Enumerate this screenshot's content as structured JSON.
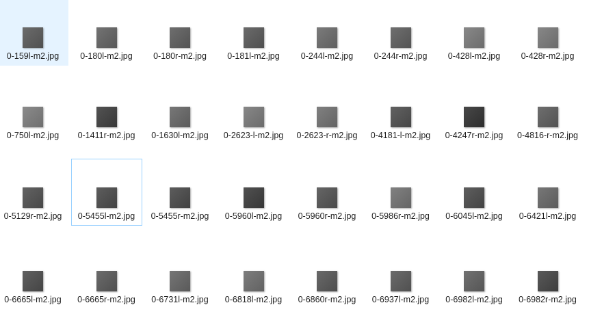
{
  "icon_name": "image-thumbnail-icon",
  "files": [
    {
      "name": "0-159l-m2.jpg",
      "tone": "#5b5b5b",
      "selected": true
    },
    {
      "name": "0-180l-m2.jpg",
      "tone": "#636363"
    },
    {
      "name": "0-180r-m2.jpg",
      "tone": "#5e5e5e"
    },
    {
      "name": "0-181l-m2.jpg",
      "tone": "#5a5a5a"
    },
    {
      "name": "0-244l-m2.jpg",
      "tone": "#6c6c6c"
    },
    {
      "name": "0-244r-m2.jpg",
      "tone": "#5f5f5f"
    },
    {
      "name": "0-428l-m2.jpg",
      "tone": "#7b7b7b"
    },
    {
      "name": "0-428r-m2.jpg",
      "tone": "#7a7a7a"
    },
    {
      "name": "0-750l-m2.jpg",
      "tone": "#7e7e7e"
    },
    {
      "name": "0-1411r-m2.jpg",
      "tone": "#3f3f3f"
    },
    {
      "name": "0-1630l-m2.jpg",
      "tone": "#686868"
    },
    {
      "name": "0-2623-l-m2.jpg",
      "tone": "#7a7a7a"
    },
    {
      "name": "0-2623-r-m2.jpg",
      "tone": "#727272"
    },
    {
      "name": "0-4181-l-m2.jpg",
      "tone": "#505050"
    },
    {
      "name": "0-4247r-m2.jpg",
      "tone": "#333333"
    },
    {
      "name": "0-4816-r-m2.jpg",
      "tone": "#5e5e5e"
    },
    {
      "name": "0-5129r-m2.jpg",
      "tone": "#515151"
    },
    {
      "name": "0-5455l-m2.jpg",
      "tone": "#4b4b4b",
      "focused": true
    },
    {
      "name": "0-5455r-m2.jpg",
      "tone": "#4a4a4a"
    },
    {
      "name": "0-5960l-m2.jpg",
      "tone": "#3d3d3d"
    },
    {
      "name": "0-5960r-m2.jpg",
      "tone": "#545454"
    },
    {
      "name": "0-5986r-m2.jpg",
      "tone": "#737373"
    },
    {
      "name": "0-6045l-m2.jpg",
      "tone": "#4c4c4c"
    },
    {
      "name": "0-6421l-m2.jpg",
      "tone": "#686868"
    },
    {
      "name": "0-6665l-m2.jpg",
      "tone": "#4e4e4e"
    },
    {
      "name": "0-6665r-m2.jpg",
      "tone": "#5a5a5a"
    },
    {
      "name": "0-6731l-m2.jpg",
      "tone": "#666666"
    },
    {
      "name": "0-6818l-m2.jpg",
      "tone": "#6f6f6f"
    },
    {
      "name": "0-6860r-m2.jpg",
      "tone": "#585858"
    },
    {
      "name": "0-6937l-m2.jpg",
      "tone": "#5b5b5b"
    },
    {
      "name": "0-6982l-m2.jpg",
      "tone": "#616161"
    },
    {
      "name": "0-6982r-m2.jpg",
      "tone": "#464646"
    }
  ]
}
